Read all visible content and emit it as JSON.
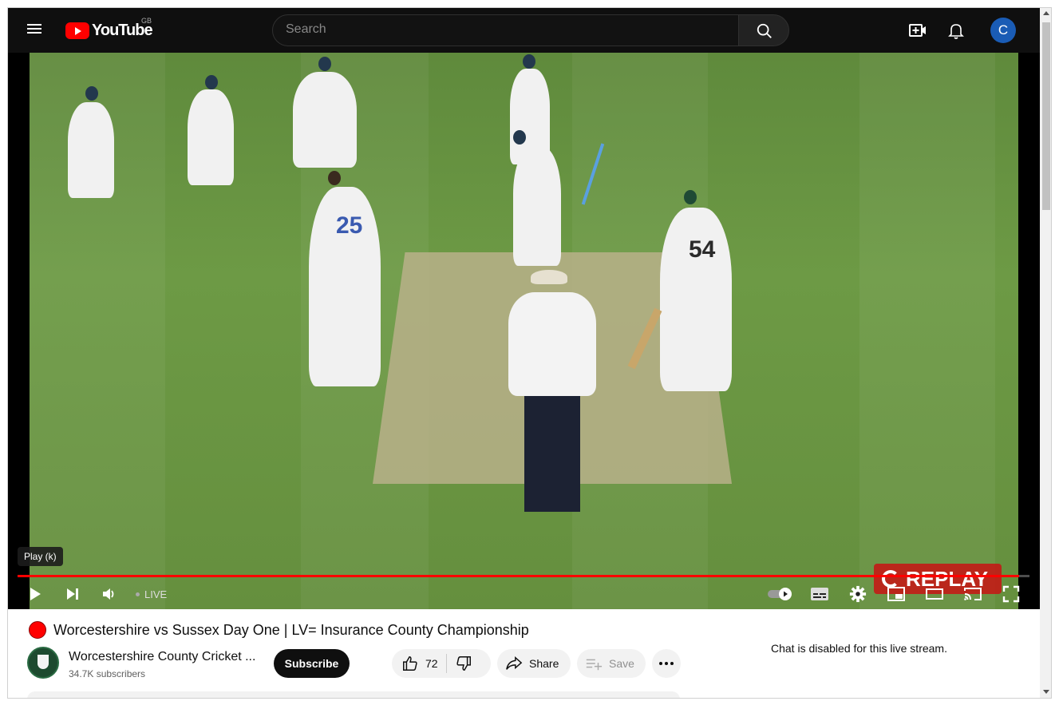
{
  "masthead": {
    "logo_text": "YouTube",
    "region": "GB",
    "search_placeholder": "Search",
    "avatar_initial": "C",
    "icons": [
      "menu-icon",
      "search-icon",
      "create-video-icon",
      "notifications-bell-icon"
    ]
  },
  "player": {
    "tooltip": "Play (k)",
    "live_label": "LIVE",
    "replay_label": "REPLAY",
    "progress_fraction": 0.99,
    "jersey_numbers": [
      "25",
      "54"
    ],
    "controls": [
      "play-icon",
      "next-icon",
      "volume-icon",
      "autoplay-toggle-icon",
      "subtitles-icon",
      "settings-icon",
      "miniplayer-icon",
      "theater-mode-icon",
      "cast-icon",
      "fullscreen-icon"
    ]
  },
  "video": {
    "title": "Worcestershire vs Sussex Day One | LV= Insurance County Championship",
    "channel_name": "Worcestershire County Cricket ...",
    "subscribers": "34.7K subscribers",
    "subscribe_label": "Subscribe",
    "likes": "72",
    "share_label": "Share",
    "save_label": "Save"
  },
  "chat": {
    "disabled_text": "Chat is disabled for this live stream."
  },
  "colors": {
    "brand_red": "#ff0000",
    "masthead_bg": "#0f0f0f",
    "avatar_bg": "#1a5cb5"
  }
}
